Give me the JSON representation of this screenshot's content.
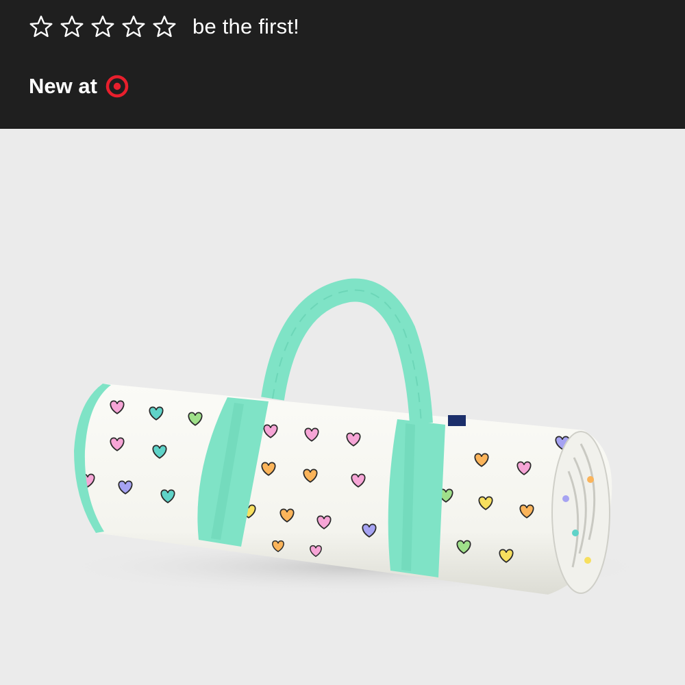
{
  "rating": {
    "stars": 5,
    "filled": 0,
    "prompt": "be the first!"
  },
  "badge": {
    "label": "New at",
    "logo": "target-bullseye-icon",
    "logo_color": "#e81f2d"
  },
  "colors": {
    "header_bg": "#1f1f1f",
    "image_bg": "#ebebeb",
    "strap": "#7fe3c6",
    "blanket": "#f7f7f2"
  },
  "product": {
    "image": "rolled-picnic-blanket-image",
    "description_icon": "heart-pattern"
  }
}
